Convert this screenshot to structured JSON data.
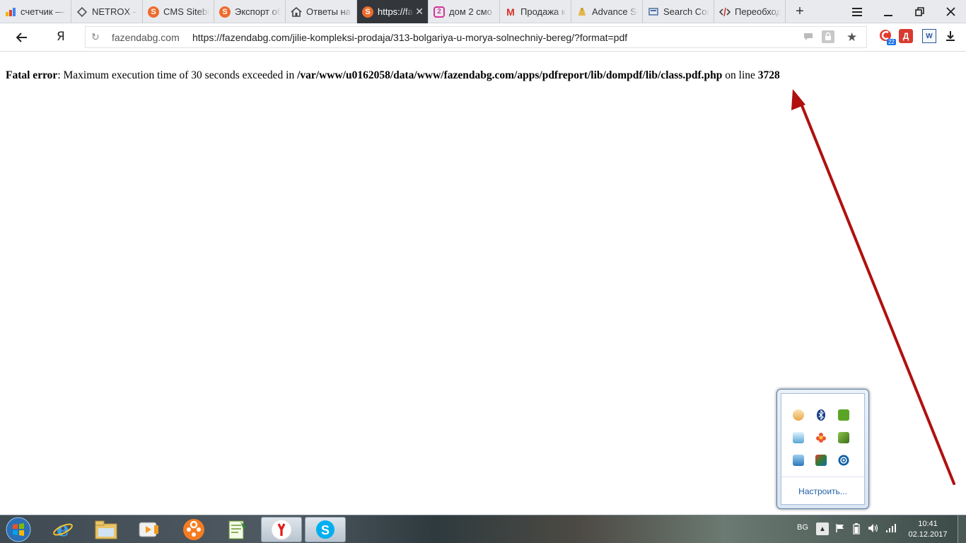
{
  "browser": {
    "tabs": [
      {
        "title": "счетчик —",
        "icon": "yandex-metrica-icon",
        "active": false
      },
      {
        "title": "NETROX - ",
        "icon": "netrox-icon",
        "active": false
      },
      {
        "title": "CMS Sitebi",
        "icon": "s-circle-icon",
        "active": false
      },
      {
        "title": "Экспорт об",
        "icon": "s-circle-icon",
        "active": false
      },
      {
        "title": "Ответы на",
        "icon": "house-icon",
        "active": false
      },
      {
        "title": "https://fa",
        "icon": "s-circle-icon",
        "active": true
      },
      {
        "title": "дом 2 смо",
        "icon": "dom2-icon",
        "active": false
      },
      {
        "title": "Продажа к",
        "icon": "gmail-icon",
        "active": false
      },
      {
        "title": "Advance Se",
        "icon": "advance-icon",
        "active": false
      },
      {
        "title": "Search Con",
        "icon": "search-console-icon",
        "active": false
      },
      {
        "title": "Переобход",
        "icon": "code-icon",
        "active": false
      }
    ],
    "new_tab_label": "+",
    "address": {
      "yandex_logo": "Я",
      "domain": "fazendabg.com",
      "url": "https://fazendabg.com/jilie-kompleksi-prodaja/313-bolgariya-u-morya-solnechniy-bereg/?format=pdf"
    },
    "extensions": {
      "badge_count": "22",
      "d_label": "Д",
      "w_label": "W"
    }
  },
  "page": {
    "error_label": "Fatal error",
    "error_text_1": ": Maximum execution time of 30 seconds exceeded in ",
    "error_path": "/var/www/u0162058/data/www/fazendabg.com/apps/pdfreport/lib/dompdf/lib/class.pdf.php",
    "error_text_2": " on line ",
    "error_line": "3728"
  },
  "annotation": {
    "arrow_color": "#b01010"
  },
  "tray_popup": {
    "icons": [
      "tray-app-icon",
      "bluetooth-icon",
      "evernote-icon",
      "tray-app2-icon",
      "flower-icon",
      "tray-app3-icon",
      "network-app-icon",
      "tray-app4-icon",
      "teamviewer-icon"
    ],
    "customize_label": "Настроить..."
  },
  "taskbar": {
    "apps": [
      "internet-explorer-icon",
      "file-explorer-icon",
      "media-player-icon",
      "ok-icon",
      "notepad-plus-icon",
      "yandex-browser-icon",
      "skype-icon"
    ],
    "lang": "BG",
    "time": "10:41",
    "date": "02.12.2017"
  }
}
